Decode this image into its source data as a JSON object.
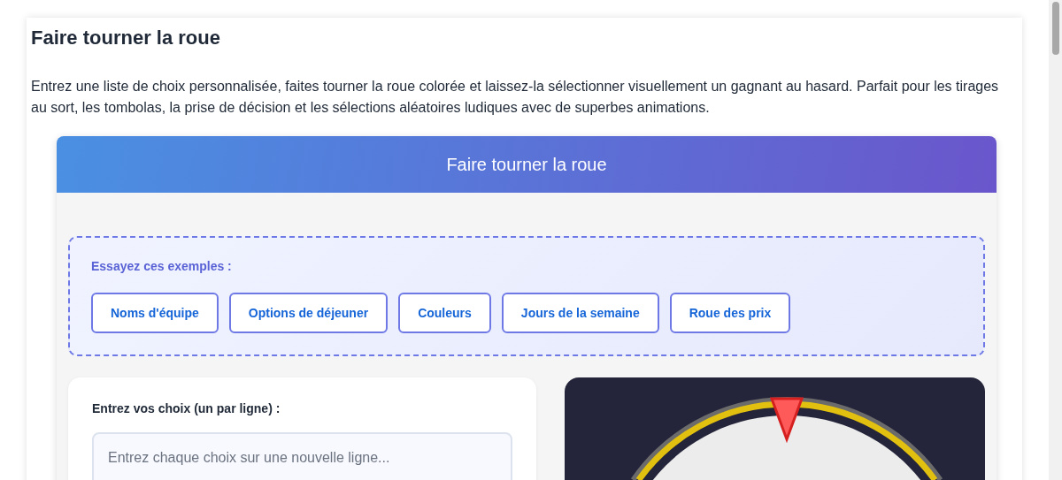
{
  "page": {
    "title": "Faire tourner la roue",
    "description": "Entrez une liste de choix personnalisée, faites tourner la roue colorée et laissez-la sélectionner visuellement un gagnant au hasard. Parfait pour les tirages au sort, les tombolas, la prise de décision et les sélections aléatoires ludiques avec de superbes animations."
  },
  "tool": {
    "header": "Faire tourner la roue",
    "examples": {
      "label": "Essayez ces exemples :",
      "buttons": [
        "Noms d'équipe",
        "Options de déjeuner",
        "Couleurs",
        "Jours de la semaine",
        "Roue des prix"
      ]
    },
    "choices": {
      "label": "Entrez vos choix (un par ligne) :",
      "placeholder": "Entrez chaque choix sur une nouvelle ligne..."
    }
  }
}
